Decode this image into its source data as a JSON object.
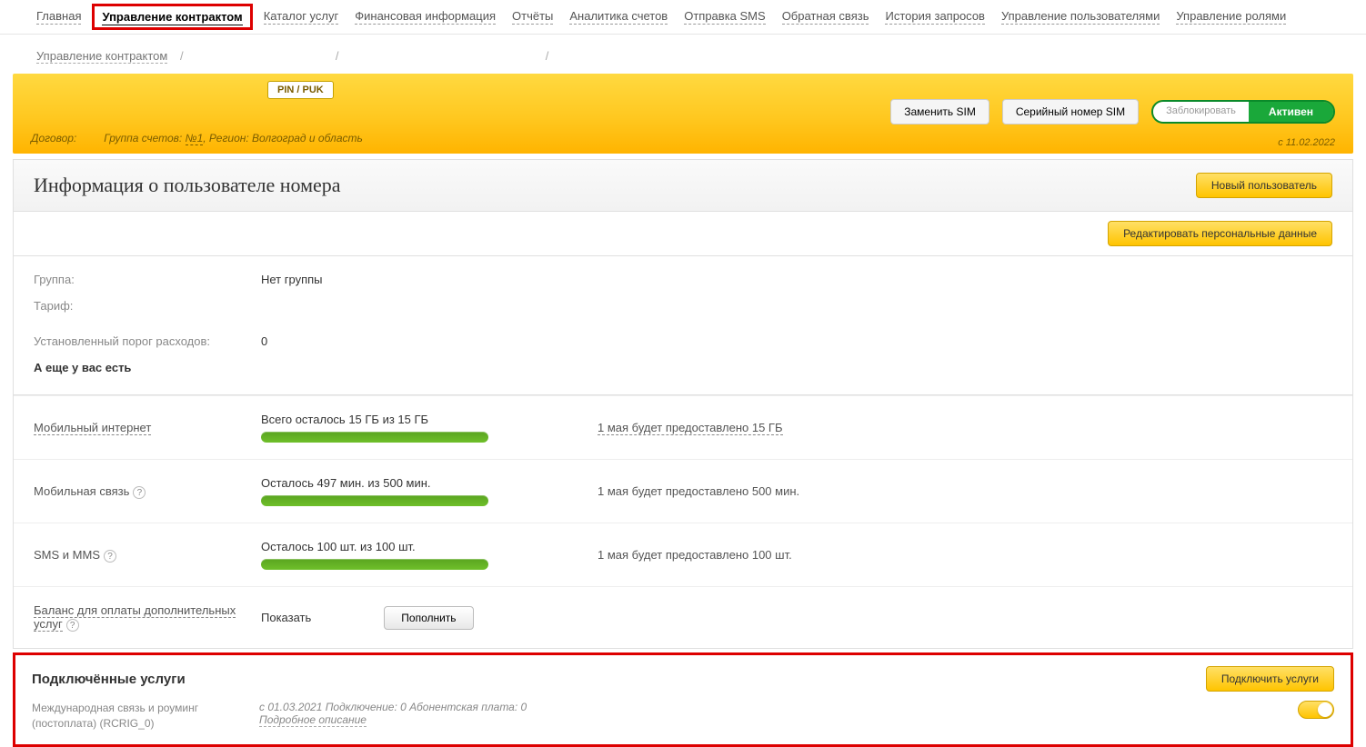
{
  "nav": {
    "items": [
      {
        "label": "Главная"
      },
      {
        "label": "Управление контрактом"
      },
      {
        "label": "Каталог услуг"
      },
      {
        "label": "Финансовая информация"
      },
      {
        "label": "Отчёты"
      },
      {
        "label": "Аналитика счетов"
      },
      {
        "label": "Отправка SMS"
      },
      {
        "label": "Обратная связь"
      },
      {
        "label": "История запросов"
      },
      {
        "label": "Управление пользователями"
      },
      {
        "label": "Управление ролями"
      }
    ]
  },
  "breadcrumb": {
    "root": "Управление контрактом",
    "sep": "/"
  },
  "yellow": {
    "pinpuk": "PIN / PUK",
    "replace_sim": "Заменить SIM",
    "serial_sim": "Серийный номер SIM",
    "block": "Заблокировать",
    "active": "Активен",
    "contract_label": "Договор:",
    "group_label": "Группа счетов:",
    "group_link": "№1",
    "region": ", Регион: Волгоград и область",
    "since": "с 11.02.2022"
  },
  "userinfo": {
    "title": "Информация о пользователе номера",
    "new_user_btn": "Новый пользователь",
    "edit_btn": "Редактировать персональные данные",
    "rows": {
      "group_label": "Группа:",
      "group_value": "Нет группы",
      "tariff_label": "Тариф:",
      "threshold_label": "Установленный порог расходов:",
      "threshold_value": "0"
    },
    "subhead": "А еще у вас есть"
  },
  "usage": {
    "internet": {
      "label": "Мобильный интернет",
      "text": "Всего осталось 15 ГБ из 15 ГБ",
      "next": "1 мая будет предоставлено 15 ГБ"
    },
    "calls": {
      "label": "Мобильная связь",
      "text": "Осталось 497 мин. из 500 мин.",
      "next": "1 мая будет предоставлено 500 мин."
    },
    "sms": {
      "label": "SMS и MMS",
      "text": "Осталось 100 шт. из 100 шт.",
      "next": "1 мая будет предоставлено 100 шт."
    },
    "balance": {
      "label": "Баланс для оплаты дополнительных услуг",
      "show": "Показать",
      "topup": "Пополнить"
    }
  },
  "services": {
    "title": "Подключённые услуги",
    "connect_btn": "Подключить услуги",
    "item": {
      "name": "Международная связь и роуминг (постоплата) (RCRIG_0)",
      "meta": "с 01.03.2021 Подключение: 0 Абонентская плата: 0",
      "detail": "Подробное описание"
    }
  }
}
